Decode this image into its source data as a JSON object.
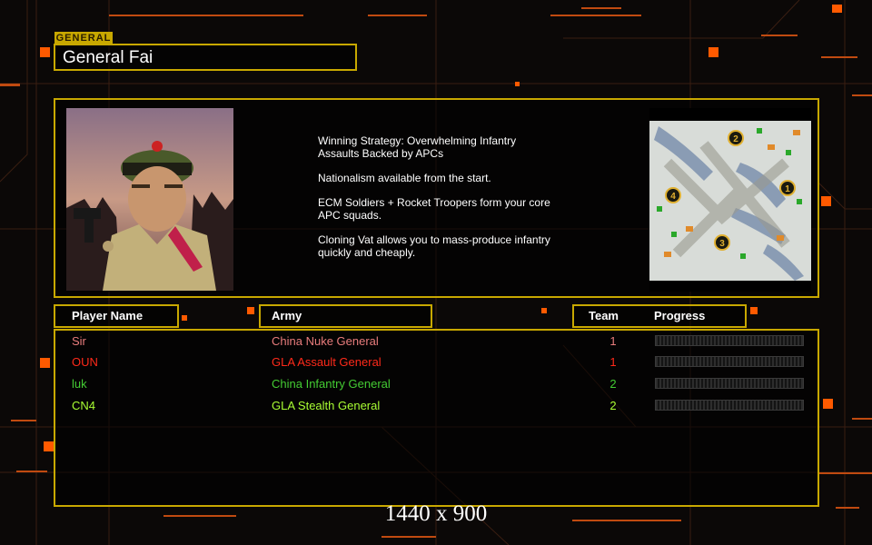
{
  "general": {
    "tag": "GENERAL",
    "name": "General Fai",
    "description": [
      "Winning Strategy: Overwhelming Infantry\n Assaults Backed by APCs",
      "Nationalism available from the start.",
      "ECM Soldiers + Rocket Troopers form your core\n APC squads.",
      "Cloning Vat allows you to mass-produce infantry\n quickly and cheaply."
    ]
  },
  "table": {
    "headers": {
      "player": "Player Name",
      "army": "Army",
      "team": "Team",
      "progress": "Progress"
    },
    "rows": [
      {
        "name": "Sir",
        "army": "China Nuke General",
        "team": "1",
        "color": "#e87c7c",
        "progress": 0
      },
      {
        "name": "OUN",
        "army": "GLA Assault General",
        "team": "1",
        "color": "#ff2a1a",
        "progress": 0
      },
      {
        "name": "luk",
        "army": "China Infantry General",
        "team": "2",
        "color": "#44cc33",
        "progress": 0
      },
      {
        "name": "CN4",
        "army": "GLA Stealth General",
        "team": "2",
        "color": "#aaff33",
        "progress": 0
      }
    ]
  },
  "minimap": {
    "start_positions": [
      "1",
      "2",
      "3",
      "4"
    ]
  },
  "footer": {
    "resolution": "1440 x 900"
  },
  "colors": {
    "frame": "#c8a800",
    "accent_orange": "#ff5a00"
  }
}
